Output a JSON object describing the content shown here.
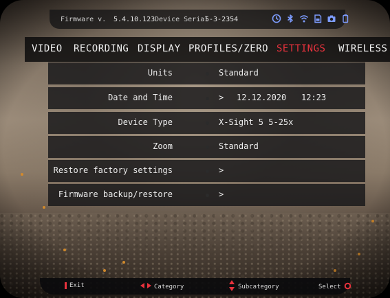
{
  "status": {
    "firmware_label": "Firmware v.",
    "firmware_value": "5.4.10.123",
    "serial_label": "Device Serial",
    "serial_value": "5-3-2354",
    "icons": [
      "timer-icon",
      "bluetooth-icon",
      "wifi-icon",
      "sd-card-icon",
      "camera-icon",
      "battery-icon"
    ]
  },
  "tabs": [
    {
      "label": "VIDEO",
      "active": false
    },
    {
      "label": "RECORDING",
      "active": false
    },
    {
      "label": "DISPLAY",
      "active": false
    },
    {
      "label": "PROFILES/ZERO",
      "active": false
    },
    {
      "label": "SETTINGS",
      "active": true
    },
    {
      "label": "WIRELESS",
      "active": false
    }
  ],
  "settings": [
    {
      "label": "Units",
      "value": "Standard"
    },
    {
      "label": "Date and Time",
      "chevron": ">",
      "date": "12.12.2020",
      "time": "12:23"
    },
    {
      "label": "Device Type",
      "value": "X-Sight 5 5-25x"
    },
    {
      "label": "Zoom",
      "value": "Standard"
    },
    {
      "label": "Restore factory settings",
      "chevron": ">"
    },
    {
      "label": "Firmware backup/restore",
      "chevron": ">"
    }
  ],
  "hints": {
    "exit": "Exit",
    "category": "Category",
    "subcategory": "Subcategory",
    "select": "Select"
  },
  "colors": {
    "accent": "#e8323d"
  }
}
